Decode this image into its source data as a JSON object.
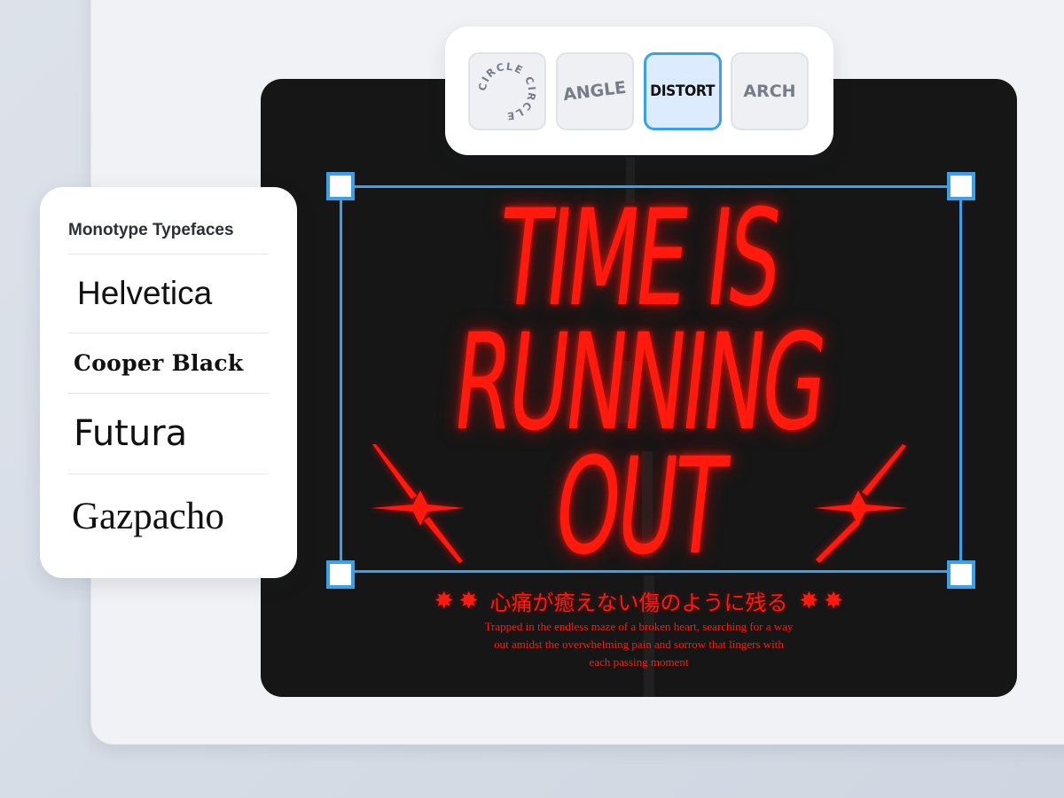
{
  "colors": {
    "neon_red": "#ff1a0d",
    "selection_blue": "#3ba0ea",
    "artboard_bg": "#161616",
    "panel_bg": "#ffffff"
  },
  "toolbar": {
    "circle_label": "CIRCLE CIRCLE",
    "angle_label": "ANGLE",
    "distort_label": "DISTORT",
    "arch_label": "ARCH",
    "active_tool": "DISTORT"
  },
  "font_panel": {
    "title": "Monotype Typefaces",
    "fonts": [
      "Helvetica",
      "Cooper Black",
      "Futura",
      "Gazpacho"
    ]
  },
  "artboard": {
    "headline": [
      "TIME IS",
      "RUNNING",
      "OUT"
    ],
    "tagline": "心痛が癒えない傷のように残る",
    "burst_glyph": "✸",
    "caption": [
      "Trapped in the endless maze of a broken heart, searching for a way",
      "out amidst the overwhelming pain and sorrow that lingers with",
      "each passing moment"
    ],
    "icons": [
      "sparkle-icon",
      "star-icon",
      "burst-icon"
    ]
  }
}
